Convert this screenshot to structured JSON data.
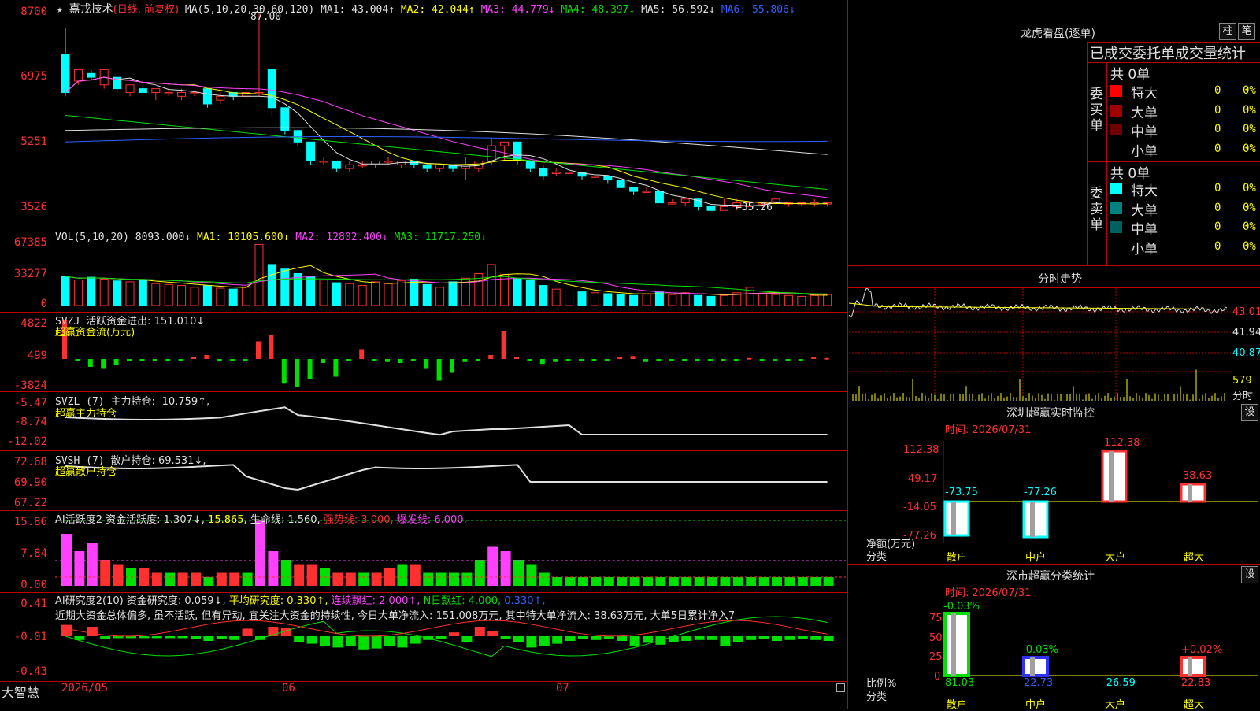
{
  "header": {
    "star": "★",
    "stock_name": "嘉戎技术",
    "mode": "(日线, 前复权)",
    "ma_label": "MA(5,10,20,30,60,120)",
    "ma1": "MA1: 43.004↑",
    "ma2": "MA2: 42.044↑",
    "ma3": "MA3: 44.779↓",
    "ma4": "MA4: 48.397↓",
    "ma5": "MA5: 56.592↓",
    "ma6": "MA6: 55.806↓",
    "high_mark": "87.00",
    "low_mark": "←35.26"
  },
  "price_axis": [
    "8700",
    "6975",
    "5251",
    "3526"
  ],
  "vol": {
    "label": "VOL(5,10,20)",
    "value": "8093.000↓",
    "ma1": "MA1: 10105.600↓",
    "ma2": "MA2: 12802.400↓",
    "ma3": "MA3: 11717.250↓",
    "axis": [
      "67385",
      "33277",
      "0"
    ]
  },
  "svzj": {
    "label": "SVZJ",
    "value": "活跃资金进出: 151.010↓",
    "subtitle": "超赢资金流(万元)",
    "axis": [
      "4822",
      "499",
      "-3824"
    ]
  },
  "svzl": {
    "label": "SVZL (7)",
    "value": "主力持仓: -10.759↑,",
    "subtitle": "超赢主力持仓",
    "axis": [
      "-5.47",
      "-8.74",
      "-12.02"
    ]
  },
  "svsh": {
    "label": "SVSH (7)",
    "value": "散户持仓: 69.531↓,",
    "subtitle": "超赢散户持仓",
    "axis": [
      "72.68",
      "69.90",
      "67.22"
    ]
  },
  "ai1": {
    "label": "AI活跃度2",
    "v1": "资金活跃度: 1.307↓,",
    "v2": "15.865,",
    "v3": "生命线: 1.560,",
    "v4": "强势线: 3.000,",
    "v5": "爆发线: 6.000,",
    "axis": [
      "15.86",
      "7.84",
      "0.00"
    ]
  },
  "ai2": {
    "label": "AI研究度2(10)",
    "v1": "资金研究度: 0.059↓,",
    "v2": "平均研究度: 0.330↑,",
    "v3": "连续飘红: 2.000↑,",
    "v4": "N日飘红: 4.000,",
    "v5": "0.330↑,",
    "comment": "近期大资金总体偏多, 虽不活跃, 但有异动, 宜关注大资金的持续性, 今日大单净流入: 151.008万元, 其中特大单净流入: 38.63万元, 大单5日累计净入7",
    "axis": [
      "0.41",
      "-0.01",
      "-0.43"
    ]
  },
  "bottom": {
    "brand": "大智慧",
    "dates": [
      "2026/05",
      "06",
      "07"
    ]
  },
  "right": {
    "lh_title": "龙虎看盘(逐单)",
    "btn_bar": "柱",
    "btn_bi": "笔",
    "stats_title": "已成交委托单成交量统计",
    "buy_header": "共 0单",
    "buy_side": "委买单",
    "sell_header": "共 0单",
    "sell_side": "委卖单",
    "rows": [
      {
        "name": "特大",
        "count": "0",
        "pct": "0%"
      },
      {
        "name": "大单",
        "count": "0",
        "pct": "0%"
      },
      {
        "name": "中单",
        "count": "0",
        "pct": "0%"
      },
      {
        "name": "小单",
        "count": "0",
        "pct": "0%"
      }
    ],
    "sell_rows": [
      {
        "name": "特大",
        "count": "0",
        "pct": "0%"
      },
      {
        "name": "大单",
        "count": "0",
        "pct": "0%"
      },
      {
        "name": "中单",
        "count": "0",
        "pct": "0%"
      },
      {
        "name": "小单",
        "count": "0",
        "pct": "0%"
      }
    ],
    "intraday_title": "分时走势",
    "intraday_axis": [
      "43.01",
      "41.94",
      "40.87",
      "579",
      "分时"
    ],
    "sz_title": "深圳超赢实时监控",
    "sz_btn": "设",
    "sz_time": "时间: 2026/07/31",
    "sz_axis": [
      "112.38",
      "49.17",
      "-14.05",
      "-77.26"
    ],
    "sz_values": [
      "-73.75",
      "-77.26",
      "112.38",
      "38.63"
    ],
    "sz_y_label": "净额(万元)",
    "sz_x_label": "分类",
    "sz_cats": [
      "散户",
      "中户",
      "大户",
      "超大"
    ],
    "cls_title": "深市超赢分类统计",
    "cls_btn": "设",
    "cls_time": "时间: 2026/07/31",
    "cls_axis": [
      "75",
      "50",
      "25",
      "0"
    ],
    "cls_top": [
      "-0.03%",
      "-0.03%",
      "",
      "+0.02%"
    ],
    "cls_bottom": [
      "81.03",
      "22.73",
      "-26.59",
      "22.83"
    ],
    "cls_y_label": "比例%",
    "cls_x_label": "分类",
    "cls_cats": [
      "散户",
      "中户",
      "大户",
      "超大"
    ]
  },
  "colors": {
    "up": "#ff3030",
    "down": "#00ffff",
    "grid": "#c00000"
  }
}
